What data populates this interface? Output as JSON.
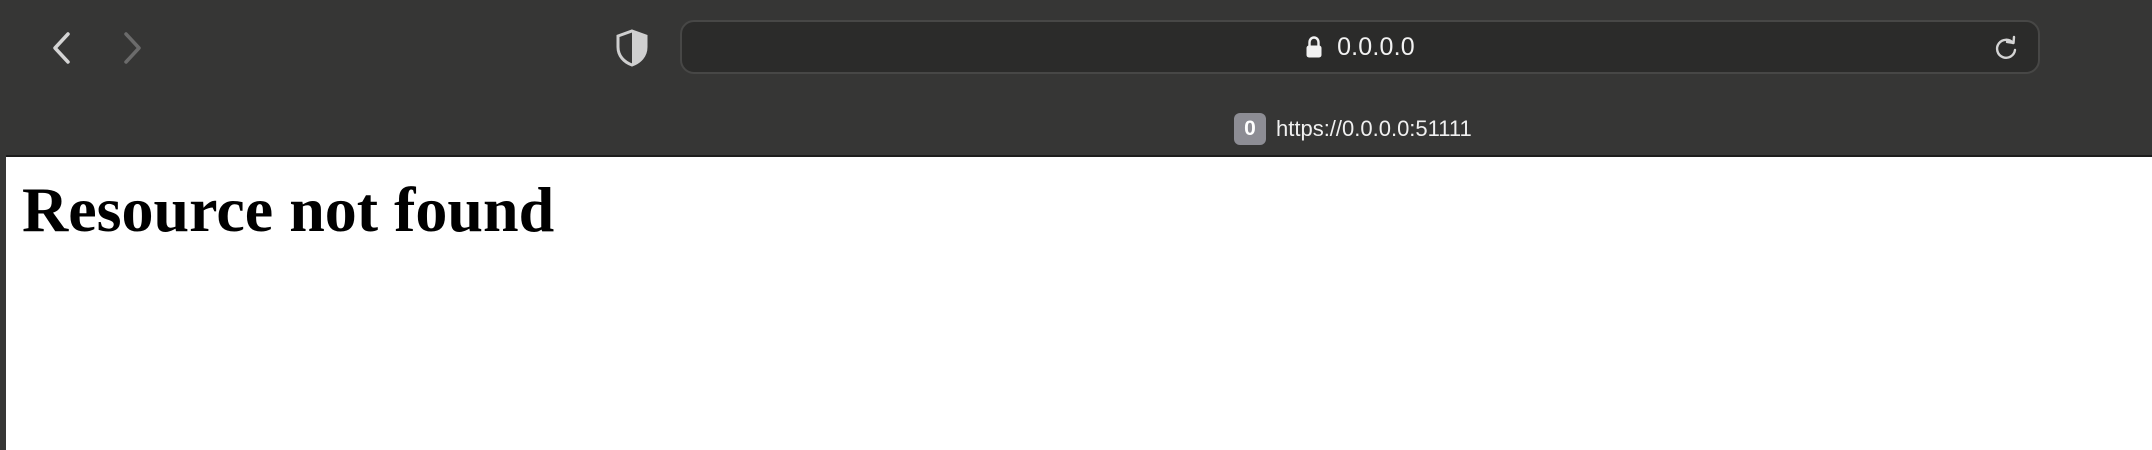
{
  "browser": {
    "address_bar": {
      "display_text": "0.0.0.0",
      "secure": true
    },
    "tab": {
      "badge": "0",
      "title": "https://0.0.0.0:51111"
    },
    "icons": {
      "back": "chevron-left-icon",
      "forward": "chevron-right-icon",
      "privacy": "shield-icon",
      "lock": "lock-icon",
      "reload": "reload-icon"
    },
    "colors": {
      "toolbar_bg": "#363635",
      "address_bg": "#2b2b2a",
      "badge_bg": "#8d8d94"
    }
  },
  "page": {
    "heading": "Resource not found"
  }
}
